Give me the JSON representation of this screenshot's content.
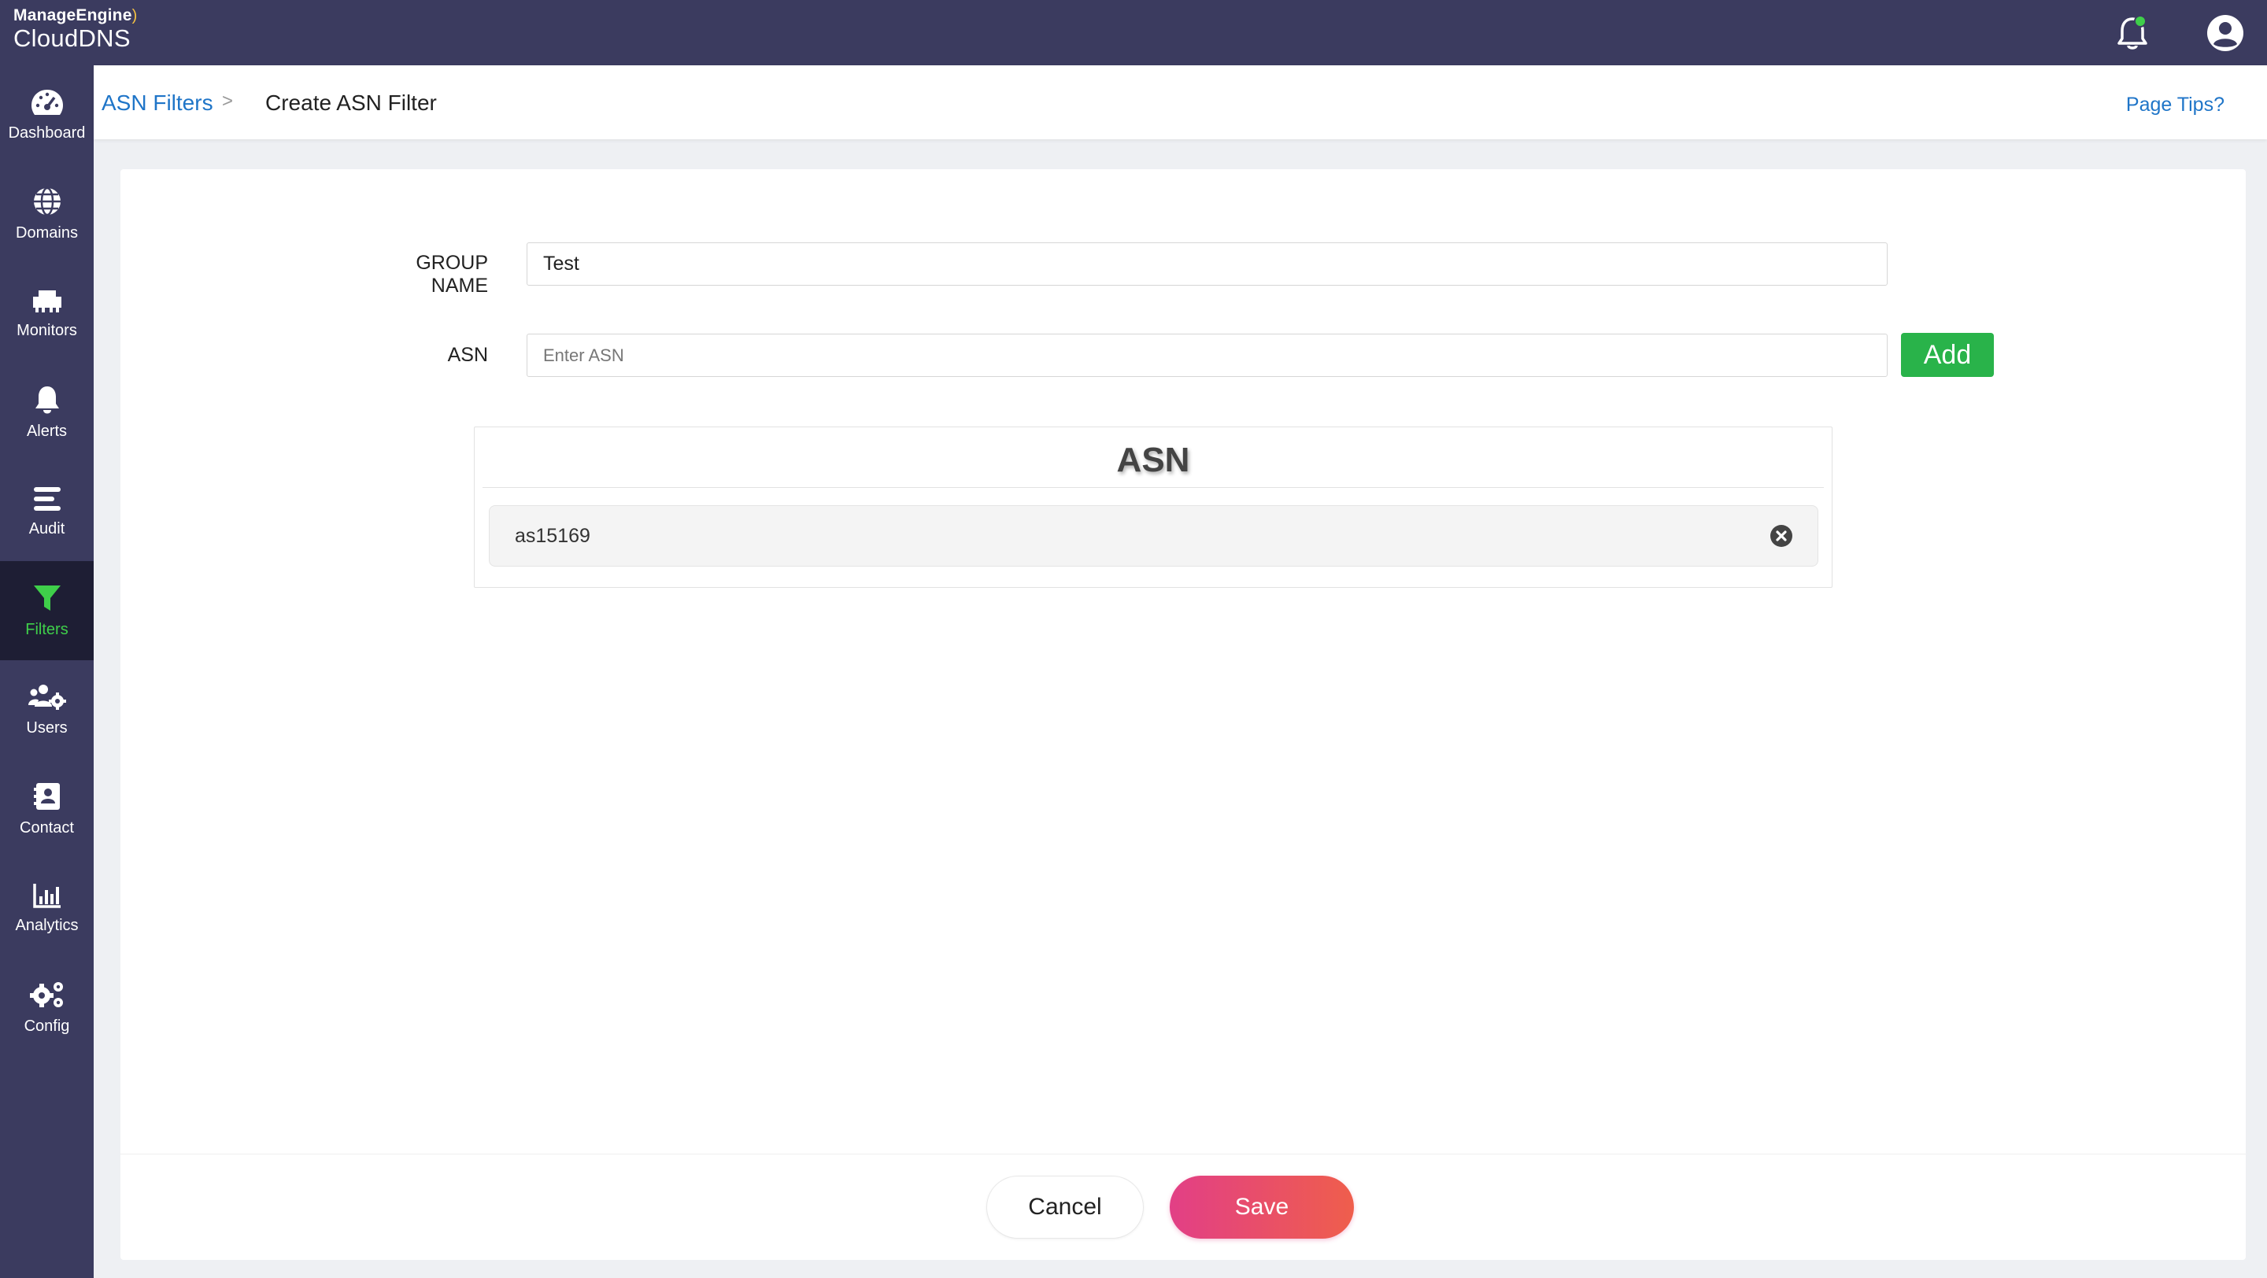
{
  "brand": {
    "company": "ManageEngine",
    "product": "CloudDNS"
  },
  "topbar": {
    "bell_icon": "bell-icon",
    "user_icon": "user-circle-icon",
    "notification_dot_color": "#3fcf4a"
  },
  "sidebar": {
    "items": [
      {
        "label": "Dashboard",
        "icon": "gauge-icon"
      },
      {
        "label": "Domains",
        "icon": "globe-icon"
      },
      {
        "label": "Monitors",
        "icon": "network-icon"
      },
      {
        "label": "Alerts",
        "icon": "bell-icon"
      },
      {
        "label": "Audit",
        "icon": "list-icon"
      },
      {
        "label": "Filters",
        "icon": "funnel-icon",
        "active": true
      },
      {
        "label": "Users",
        "icon": "users-gear-icon"
      },
      {
        "label": "Contact",
        "icon": "contact-book-icon"
      },
      {
        "label": "Analytics",
        "icon": "bar-chart-icon"
      },
      {
        "label": "Config",
        "icon": "gears-icon"
      }
    ]
  },
  "breadcrumb": {
    "parent": "ASN Filters",
    "separator": ">",
    "current": "Create ASN Filter"
  },
  "header": {
    "page_tips": "Page Tips?"
  },
  "form": {
    "group_name_label": "GROUP NAME",
    "group_name_value": "Test",
    "asn_label": "ASN",
    "asn_placeholder": "Enter ASN",
    "add_label": "Add"
  },
  "asn_list": {
    "title": "ASN",
    "items": [
      {
        "value": "as15169"
      }
    ]
  },
  "footer": {
    "cancel_label": "Cancel",
    "save_label": "Save"
  },
  "colors": {
    "topbar": "#3b3b5f",
    "active_nav": "#3fcf4a",
    "link": "#1f75c8",
    "add_button": "#29b34a",
    "save_gradient_start": "#e23f86",
    "save_gradient_end": "#ef5e4c"
  }
}
